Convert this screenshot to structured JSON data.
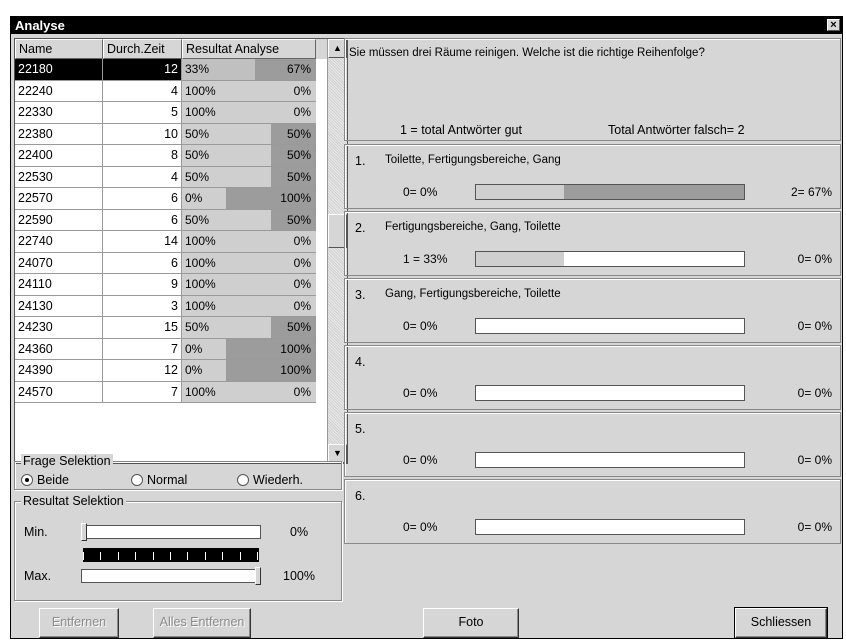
{
  "window": {
    "title": "Analyse",
    "close_icon": "×"
  },
  "table": {
    "headers": [
      "Name",
      "Durch.Zeit",
      "Resultat Analyse"
    ],
    "rows": [
      {
        "name": "22180",
        "zeit": "12",
        "good": "33%",
        "bad": "67%",
        "good_pct": 33,
        "selected": true
      },
      {
        "name": "22240",
        "zeit": "4",
        "good": "100%",
        "bad": "0%",
        "good_pct": 100
      },
      {
        "name": "22330",
        "zeit": "5",
        "good": "100%",
        "bad": "0%",
        "good_pct": 100
      },
      {
        "name": "22380",
        "zeit": "10",
        "good": "50%",
        "bad": "50%",
        "good_pct": 50
      },
      {
        "name": "22400",
        "zeit": "8",
        "good": "50%",
        "bad": "50%",
        "good_pct": 50
      },
      {
        "name": "22530",
        "zeit": "4",
        "good": "50%",
        "bad": "50%",
        "good_pct": 50
      },
      {
        "name": "22570",
        "zeit": "6",
        "good": "0%",
        "bad": "100%",
        "good_pct": 0
      },
      {
        "name": "22590",
        "zeit": "6",
        "good": "50%",
        "bad": "50%",
        "good_pct": 50
      },
      {
        "name": "22740",
        "zeit": "14",
        "good": "100%",
        "bad": "0%",
        "good_pct": 100
      },
      {
        "name": "24070",
        "zeit": "6",
        "good": "100%",
        "bad": "0%",
        "good_pct": 100
      },
      {
        "name": "24110",
        "zeit": "9",
        "good": "100%",
        "bad": "0%",
        "good_pct": 100
      },
      {
        "name": "24130",
        "zeit": "3",
        "good": "100%",
        "bad": "0%",
        "good_pct": 100
      },
      {
        "name": "24230",
        "zeit": "15",
        "good": "50%",
        "bad": "50%",
        "good_pct": 50
      },
      {
        "name": "24360",
        "zeit": "7",
        "good": "0%",
        "bad": "100%",
        "good_pct": 0
      },
      {
        "name": "24390",
        "zeit": "12",
        "good": "0%",
        "bad": "100%",
        "good_pct": 0
      },
      {
        "name": "24570",
        "zeit": "7",
        "good": "100%",
        "bad": "0%",
        "good_pct": 100
      }
    ]
  },
  "frage_selektion": {
    "title": "Frage Selektion",
    "options": [
      {
        "label": "Beide",
        "checked": true
      },
      {
        "label": "Normal",
        "checked": false
      },
      {
        "label": "Wiederh.",
        "checked": false
      }
    ]
  },
  "resultat_selektion": {
    "title": "Resultat Selektion",
    "min_label": "Min.",
    "min_value": "0%",
    "max_label": "Max.",
    "max_value": "100%"
  },
  "question": {
    "text": "Sie müssen drei Räume reinigen. Welche ist  die richtige Reihenfolge?",
    "stat_good": "1 = total Antwörter gut",
    "stat_bad": "Total Antwörter falsch= 2"
  },
  "answers": [
    {
      "num": "1.",
      "text": "Toilette, Fertigungsbereiche, Gang",
      "left": "0= 0%",
      "right": "2= 67%",
      "fill_pct": 33,
      "bad": true
    },
    {
      "num": "2.",
      "text": "Fertigungsbereiche, Gang, Toilette",
      "left": "1 = 33%",
      "right": "0= 0%",
      "fill_pct": 33,
      "bad": false
    },
    {
      "num": "3.",
      "text": "Gang, Fertigungsbereiche, Toilette",
      "left": "0= 0%",
      "right": "0= 0%",
      "fill_pct": 0,
      "bad": false
    },
    {
      "num": "4.",
      "text": "",
      "left": "0= 0%",
      "right": "0= 0%",
      "fill_pct": 0,
      "bad": false
    },
    {
      "num": "5.",
      "text": "",
      "left": "0= 0%",
      "right": "0= 0%",
      "fill_pct": 0,
      "bad": false
    },
    {
      "num": "6.",
      "text": "",
      "left": "0= 0%",
      "right": "0= 0%",
      "fill_pct": 0,
      "bad": false
    }
  ],
  "buttons": {
    "entfernen": "Entfernen",
    "alles_entfernen": "Alles Entfernen",
    "foto": "Foto",
    "schliessen": "Schliessen"
  }
}
